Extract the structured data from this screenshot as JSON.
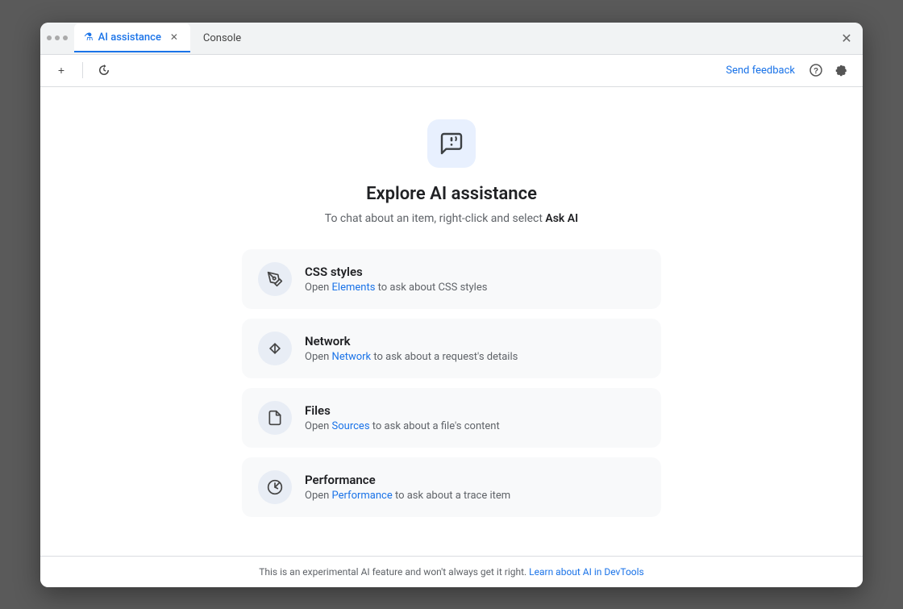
{
  "window": {
    "title": "AI assistance"
  },
  "tabs": [
    {
      "id": "ai-assistance",
      "label": "AI assistance",
      "icon": "⚗",
      "active": true,
      "closable": true
    },
    {
      "id": "console",
      "label": "Console",
      "active": false,
      "closable": false
    }
  ],
  "toolbar": {
    "new_tab_label": "+",
    "history_icon": "↺",
    "send_feedback_label": "Send feedback",
    "help_icon": "?",
    "settings_icon": "⚙"
  },
  "explore": {
    "icon_alt": "AI chat icon",
    "title": "Explore AI assistance",
    "subtitle_text": "To chat about an item, right-click and select ",
    "subtitle_bold": "Ask AI",
    "features": [
      {
        "id": "css-styles",
        "icon": "✏",
        "title": "CSS styles",
        "desc_prefix": "Open ",
        "link_label": "Elements",
        "desc_suffix": " to ask about CSS styles"
      },
      {
        "id": "network",
        "icon": "↕",
        "title": "Network",
        "desc_prefix": "Open ",
        "link_label": "Network",
        "desc_suffix": " to ask about a request's details"
      },
      {
        "id": "files",
        "icon": "📄",
        "title": "Files",
        "desc_prefix": "Open ",
        "link_label": "Sources",
        "desc_suffix": " to ask about a file's content"
      },
      {
        "id": "performance",
        "icon": "⏱",
        "title": "Performance",
        "desc_prefix": "Open ",
        "link_label": "Performance",
        "desc_suffix": " to ask about a trace item"
      }
    ]
  },
  "footer": {
    "text": "This is an experimental AI feature and won't always get it right. ",
    "link_label": "Learn about AI in DevTools"
  }
}
